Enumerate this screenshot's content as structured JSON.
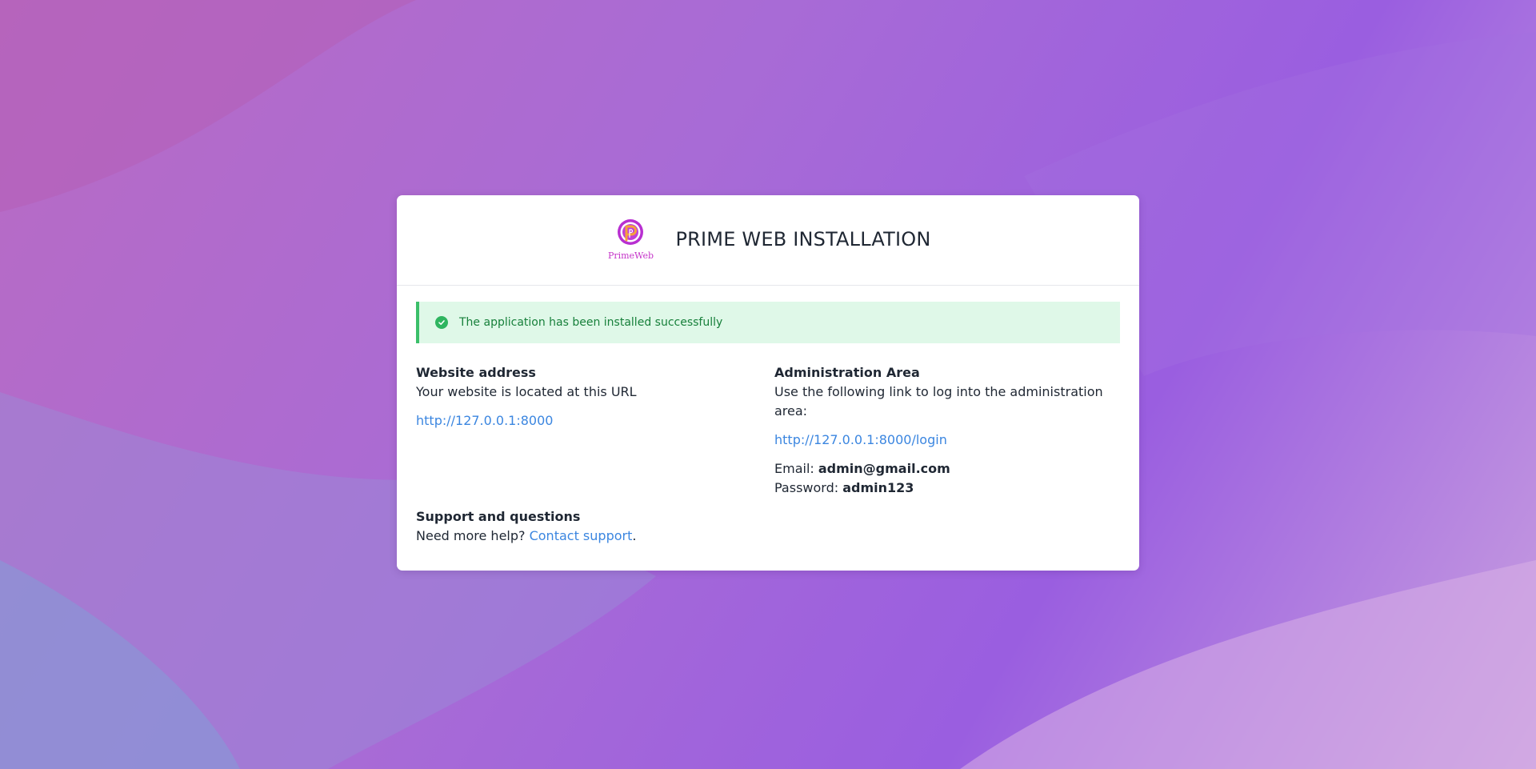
{
  "header": {
    "logo_text": "PrimeWeb",
    "title": "PRIME WEB INSTALLATION"
  },
  "alert": {
    "message": "The application has been installed successfully",
    "icon": "check-circle-icon"
  },
  "website": {
    "heading": "Website address",
    "description": "Your website is located at this URL",
    "url": "http://127.0.0.1:8000"
  },
  "admin": {
    "heading": "Administration Area",
    "description": "Use the following link to log into the administration area:",
    "url": "http://127.0.0.1:8000/login",
    "email_label": "Email: ",
    "email_value": "admin@gmail.com",
    "password_label": "Password: ",
    "password_value": "admin123"
  },
  "support": {
    "heading": "Support and questions",
    "prefix": "Need more help? ",
    "link_text": "Contact support",
    "suffix": "."
  },
  "colors": {
    "accent_link": "#3b86e0",
    "success_bg": "#dff8e8",
    "success_border": "#3bbf6a",
    "success_text": "#17803b",
    "logo_magenta": "#c535c9"
  }
}
